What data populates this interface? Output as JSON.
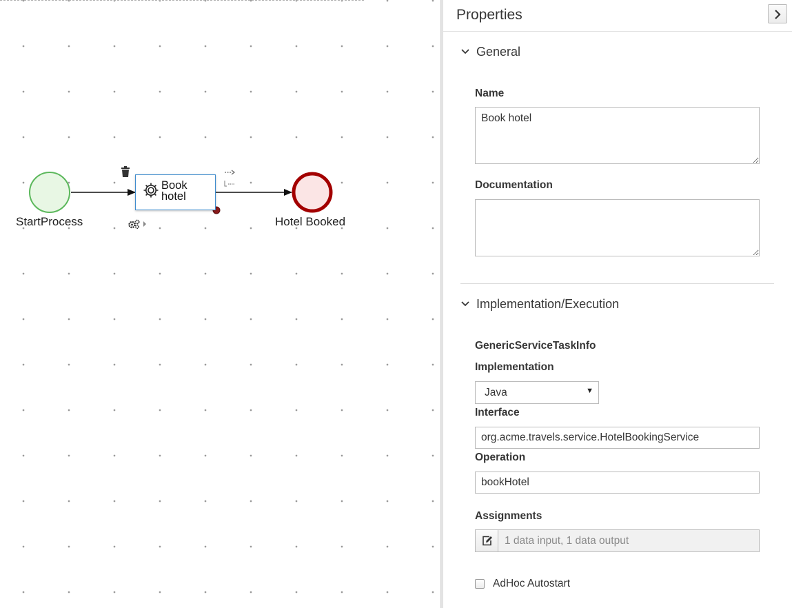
{
  "diagram": {
    "start_event_label": "StartProcess",
    "task_label": "Book\nhotel",
    "end_event_label": "Hotel Booked",
    "colors": {
      "start_fill": "#e8f7e4",
      "start_stroke": "#5cb85c",
      "end_fill": "#fbe5e5",
      "end_stroke": "#a30000",
      "task_border": "#3d8bcd"
    }
  },
  "properties": {
    "title": "Properties",
    "collapse_icon": "chevron-right-icon",
    "general": {
      "header": "General",
      "name_label": "Name",
      "name_value": "Book hotel",
      "documentation_label": "Documentation",
      "documentation_value": ""
    },
    "implementation": {
      "header": "Implementation/Execution",
      "task_info": "GenericServiceTaskInfo",
      "implementation_label": "Implementation",
      "implementation_value": "Java",
      "interface_label": "Interface",
      "interface_value": "org.acme.travels.service.HotelBookingService",
      "operation_label": "Operation",
      "operation_value": "bookHotel",
      "assignments_label": "Assignments",
      "assignments_value": "1 data input, 1 data output",
      "adhoc_label": "AdHoc Autostart"
    }
  }
}
